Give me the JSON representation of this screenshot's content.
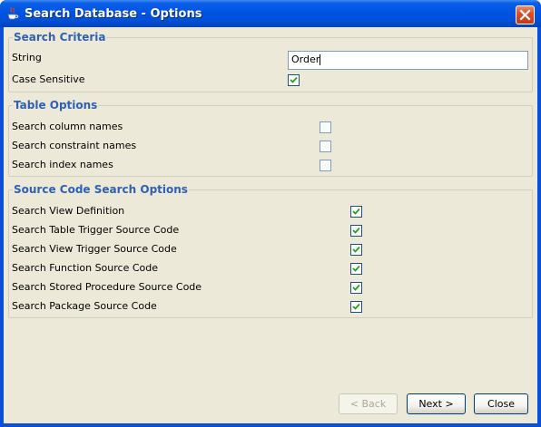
{
  "window": {
    "title": "Search Database - Options"
  },
  "search_criteria": {
    "legend": "Search Criteria",
    "string_label": "String",
    "string_value": "Order",
    "case_sensitive_label": "Case Sensitive",
    "case_sensitive_checked": true
  },
  "table_options": {
    "legend": "Table Options",
    "items": [
      {
        "label": "Search column names",
        "checked": false
      },
      {
        "label": "Search constraint names",
        "checked": false
      },
      {
        "label": "Search index names",
        "checked": false
      }
    ]
  },
  "source_options": {
    "legend": "Source Code Search Options",
    "items": [
      {
        "label": "Search View Definition",
        "checked": true
      },
      {
        "label": "Search Table Trigger Source Code",
        "checked": true
      },
      {
        "label": "Search View Trigger Source Code",
        "checked": true
      },
      {
        "label": "Search Function Source Code",
        "checked": true
      },
      {
        "label": "Search Stored Procedure Source Code",
        "checked": true
      },
      {
        "label": "Search Package Source Code",
        "checked": true
      }
    ]
  },
  "buttons": {
    "back": "< Back",
    "next": "Next >",
    "close": "Close"
  },
  "colors": {
    "titlebar": "#0054e3",
    "dialog_bg": "#ece9d8",
    "legend_text": "#2f60b8",
    "check_mark": "#21a121"
  },
  "icons": {
    "app": "java-cup-icon",
    "close": "close-x-icon",
    "check": "check-mark-icon"
  }
}
